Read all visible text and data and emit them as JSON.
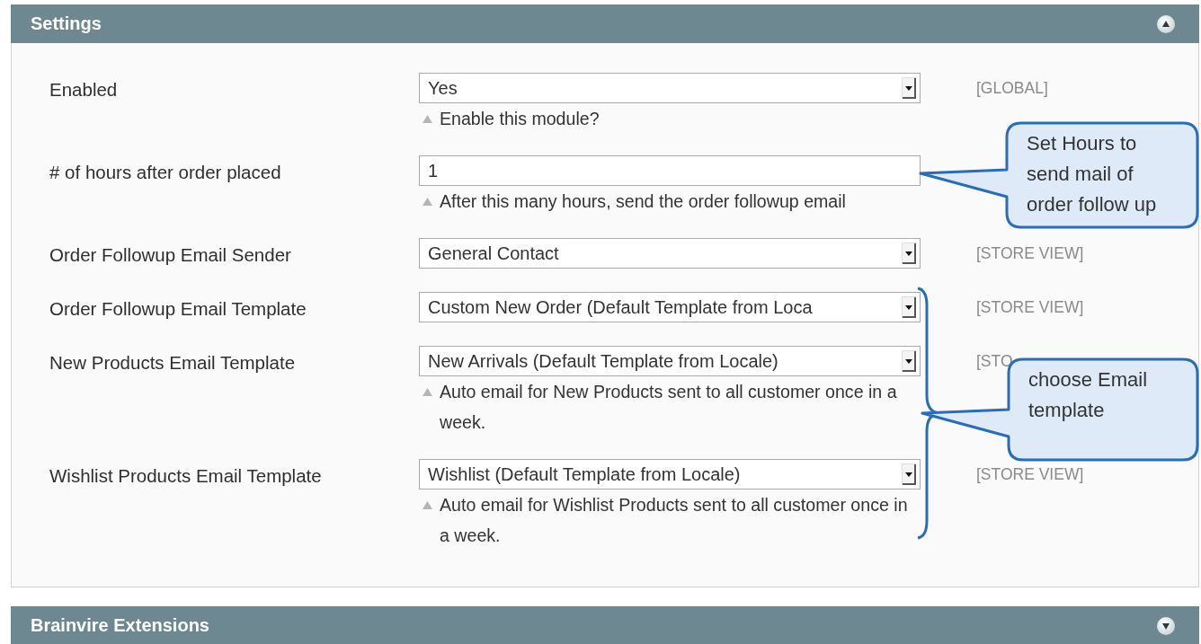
{
  "sections": [
    {
      "title": "Settings",
      "expanded": true,
      "rows": [
        {
          "label": "Enabled",
          "kind": "select",
          "value": "Yes",
          "note": "Enable this module?",
          "scope": "[GLOBAL]"
        },
        {
          "label": "# of hours after order placed",
          "kind": "text",
          "value": "1",
          "note": "After this many hours, send the order followup email"
        },
        {
          "label": "Order Followup Email Sender",
          "kind": "select",
          "value": "General Contact",
          "scope": "[STORE VIEW]"
        },
        {
          "label": "Order Followup Email Template",
          "kind": "select",
          "value": "Custom New Order (Default Template from Loca",
          "scope": "[STORE VIEW]"
        },
        {
          "label": "New Products Email Template",
          "kind": "select",
          "value": "New Arrivals (Default Template from Locale)",
          "note": "Auto email for New Products sent to all customer once in a week.",
          "scope": "[STO"
        },
        {
          "label": "Wishlist Products Email Template",
          "kind": "select",
          "value": "Wishlist (Default Template from Locale)",
          "note": "Auto email for Wishlist Products sent to all customer once in a week.",
          "scope": "[STORE VIEW]"
        }
      ],
      "callouts": [
        {
          "text": "Set Hours to send mail of order follow up"
        },
        {
          "text": "choose Email template"
        }
      ]
    },
    {
      "title": "Brainvire Extensions",
      "expanded": false
    }
  ]
}
